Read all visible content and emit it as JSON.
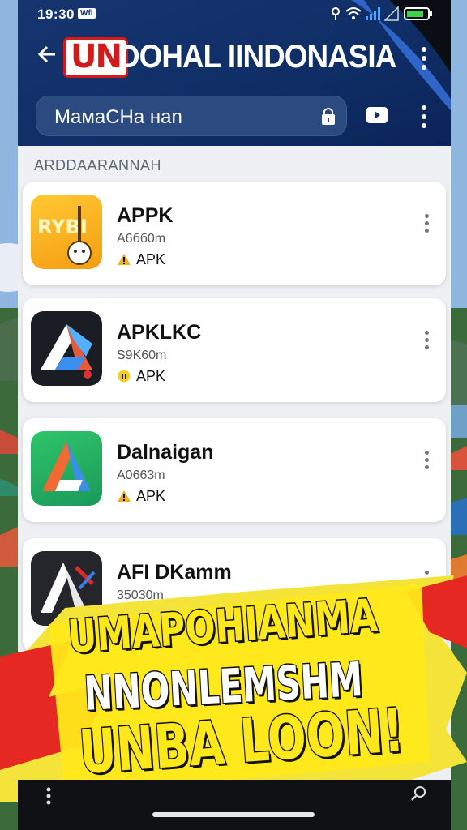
{
  "status_bar": {
    "time": "19:30",
    "badge": "Wfi"
  },
  "header": {
    "brand_logo": "UN",
    "title": "DOHAL IINDONASIA",
    "search_value": "MaмaCHa нan"
  },
  "section": {
    "label": "ARDDAARANNAH"
  },
  "apps": [
    {
      "name": "APPK",
      "size": "A6бб0m",
      "type": "APK",
      "icon_text": "RYBI",
      "icon": "guitar-app-icon",
      "status_icon": "warning-icon"
    },
    {
      "name": "APKLKC",
      "size": "S9K60m",
      "type": "APK",
      "icon": "drive-app-icon",
      "status_icon": "badge-icon"
    },
    {
      "name": "Dalnaigan",
      "size": "A0663m",
      "type": "APK",
      "icon": "triangle-app-icon",
      "status_icon": "warning-icon"
    },
    {
      "name": "AFI DKamm",
      "size": "35030m",
      "icon": "delta-app-icon"
    }
  ],
  "promo": {
    "line1": "UMAPOHIANMA",
    "line2": "NNONLEMSHM",
    "line3": "UNBA LOON!"
  },
  "colors": {
    "header_bg": "#0f2e66",
    "brand_red": "#d31b1b",
    "promo_yellow": "#ffe81a"
  }
}
